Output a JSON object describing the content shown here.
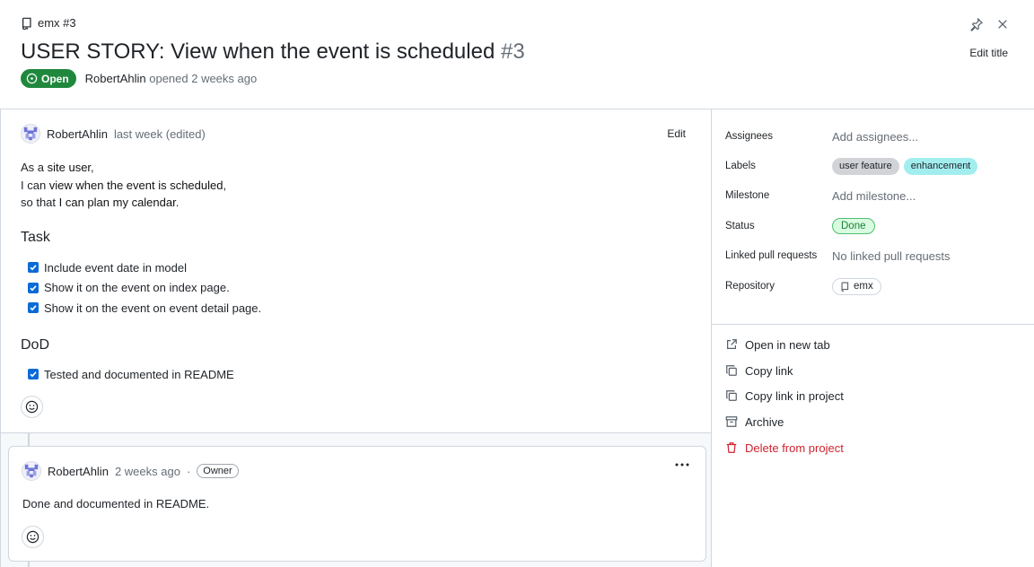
{
  "header": {
    "repo_ref": "emx #3",
    "title": "USER STORY: View when the event is scheduled",
    "number": "#3",
    "state": "Open",
    "author": "RobertAhlin",
    "opened_text": "opened 2 weeks ago",
    "edit_title": "Edit title",
    "pin_icon": "pin-icon",
    "close_icon": "close-icon"
  },
  "issue_body": {
    "author": "RobertAhlin",
    "when": "last week (edited)",
    "edit_label": "Edit",
    "story": {
      "l1_pre": "As a ",
      "l1_bold": "site user",
      "l1_post": ",",
      "l2_pre": "I can ",
      "l2_bold": "view when the event is scheduled",
      "l2_post": ",",
      "l3_pre": "so that ",
      "l3_bold": "I can plan my calendar",
      "l3_post": "."
    },
    "task_heading": "Task",
    "tasks": [
      {
        "label": "Include event date in model",
        "checked": true
      },
      {
        "label": "Show it on the event on index page.",
        "checked": true
      },
      {
        "label": "Show it on the event on event detail page.",
        "checked": true
      }
    ],
    "dod_heading": "DoD",
    "dod": [
      {
        "label": "Tested and documented in README",
        "checked": true
      }
    ]
  },
  "comment": {
    "author": "RobertAhlin",
    "when": "2 weeks ago",
    "separator": "·",
    "role": "Owner",
    "text": "Done and documented in README."
  },
  "sidebar": {
    "assignees_label": "Assignees",
    "assignees_value": "Add assignees...",
    "labels_label": "Labels",
    "labels": [
      {
        "name": "user feature",
        "color": "#d1d3d6"
      },
      {
        "name": "enhancement",
        "color": "#a2eeef"
      }
    ],
    "milestone_label": "Milestone",
    "milestone_value": "Add milestone...",
    "status_label": "Status",
    "status_value": "Done",
    "linked_label": "Linked pull requests",
    "linked_value": "No linked pull requests",
    "repository_label": "Repository",
    "repository_value": "emx",
    "actions": {
      "open_new_tab": "Open in new tab",
      "copy_link": "Copy link",
      "copy_link_project": "Copy link in project",
      "archive": "Archive",
      "delete": "Delete from project"
    }
  },
  "colors": {
    "open_green": "#1f883d",
    "danger_red": "#cf222e",
    "checkbox_blue": "#0b6bd6",
    "border": "#d0d7de"
  }
}
